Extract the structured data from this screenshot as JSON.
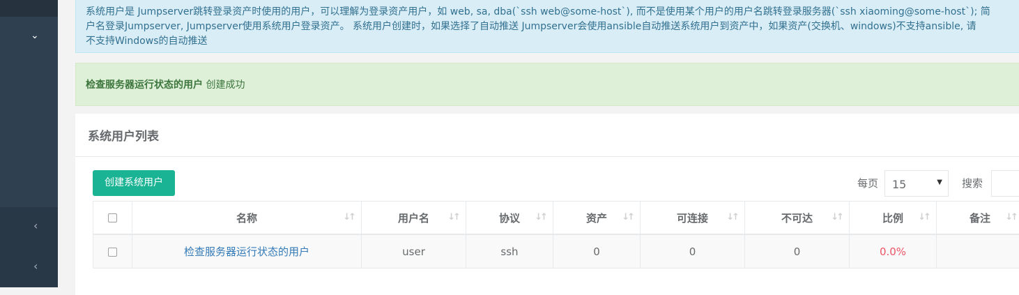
{
  "sidebar": {
    "icons": [
      "chevron-down-icon",
      "chevron-left-icon",
      "chevron-left-icon"
    ]
  },
  "info_alert": {
    "lines": [
      "系统用户是 Jumpserver跳转登录资产时使用的用户，可以理解为登录资产用户，如 web, sa, dba(`ssh web@some-host`), 而不是使用某个用户的用户名跳转登录服务器(`ssh xiaoming@some-host`); 简",
      "户名登录Jumpserver, Jumpserver使用系统用户登录资产。 系统用户创建时，如果选择了自动推送 Jumpserver会使用ansible自动推送系统用户到资产中，如果资产(交换机、windows)不支持ansible, 请",
      "不支持Windows的自动推送"
    ]
  },
  "success_alert": {
    "name": "检查服务器运行状态的用户",
    "message": "创建成功"
  },
  "panel": {
    "title": "系统用户列表",
    "create_button": "创建系统用户",
    "page_length_label": "每页",
    "page_length_value": "15",
    "search_label": "搜索",
    "search_value": ""
  },
  "table": {
    "columns": [
      "名称",
      "用户名",
      "协议",
      "资产",
      "可连接",
      "不可达",
      "比例",
      "备注"
    ],
    "rows": [
      {
        "name": "检查服务器运行状态的用户",
        "username": "user",
        "protocol": "ssh",
        "assets": "0",
        "reachable": "0",
        "unreachable": "0",
        "ratio": "0.0%",
        "comment": ""
      }
    ]
  },
  "colors": {
    "primary": "#1ab394",
    "link": "#337ab7",
    "danger": "#ed5565",
    "sidebar": "#2f4050"
  }
}
